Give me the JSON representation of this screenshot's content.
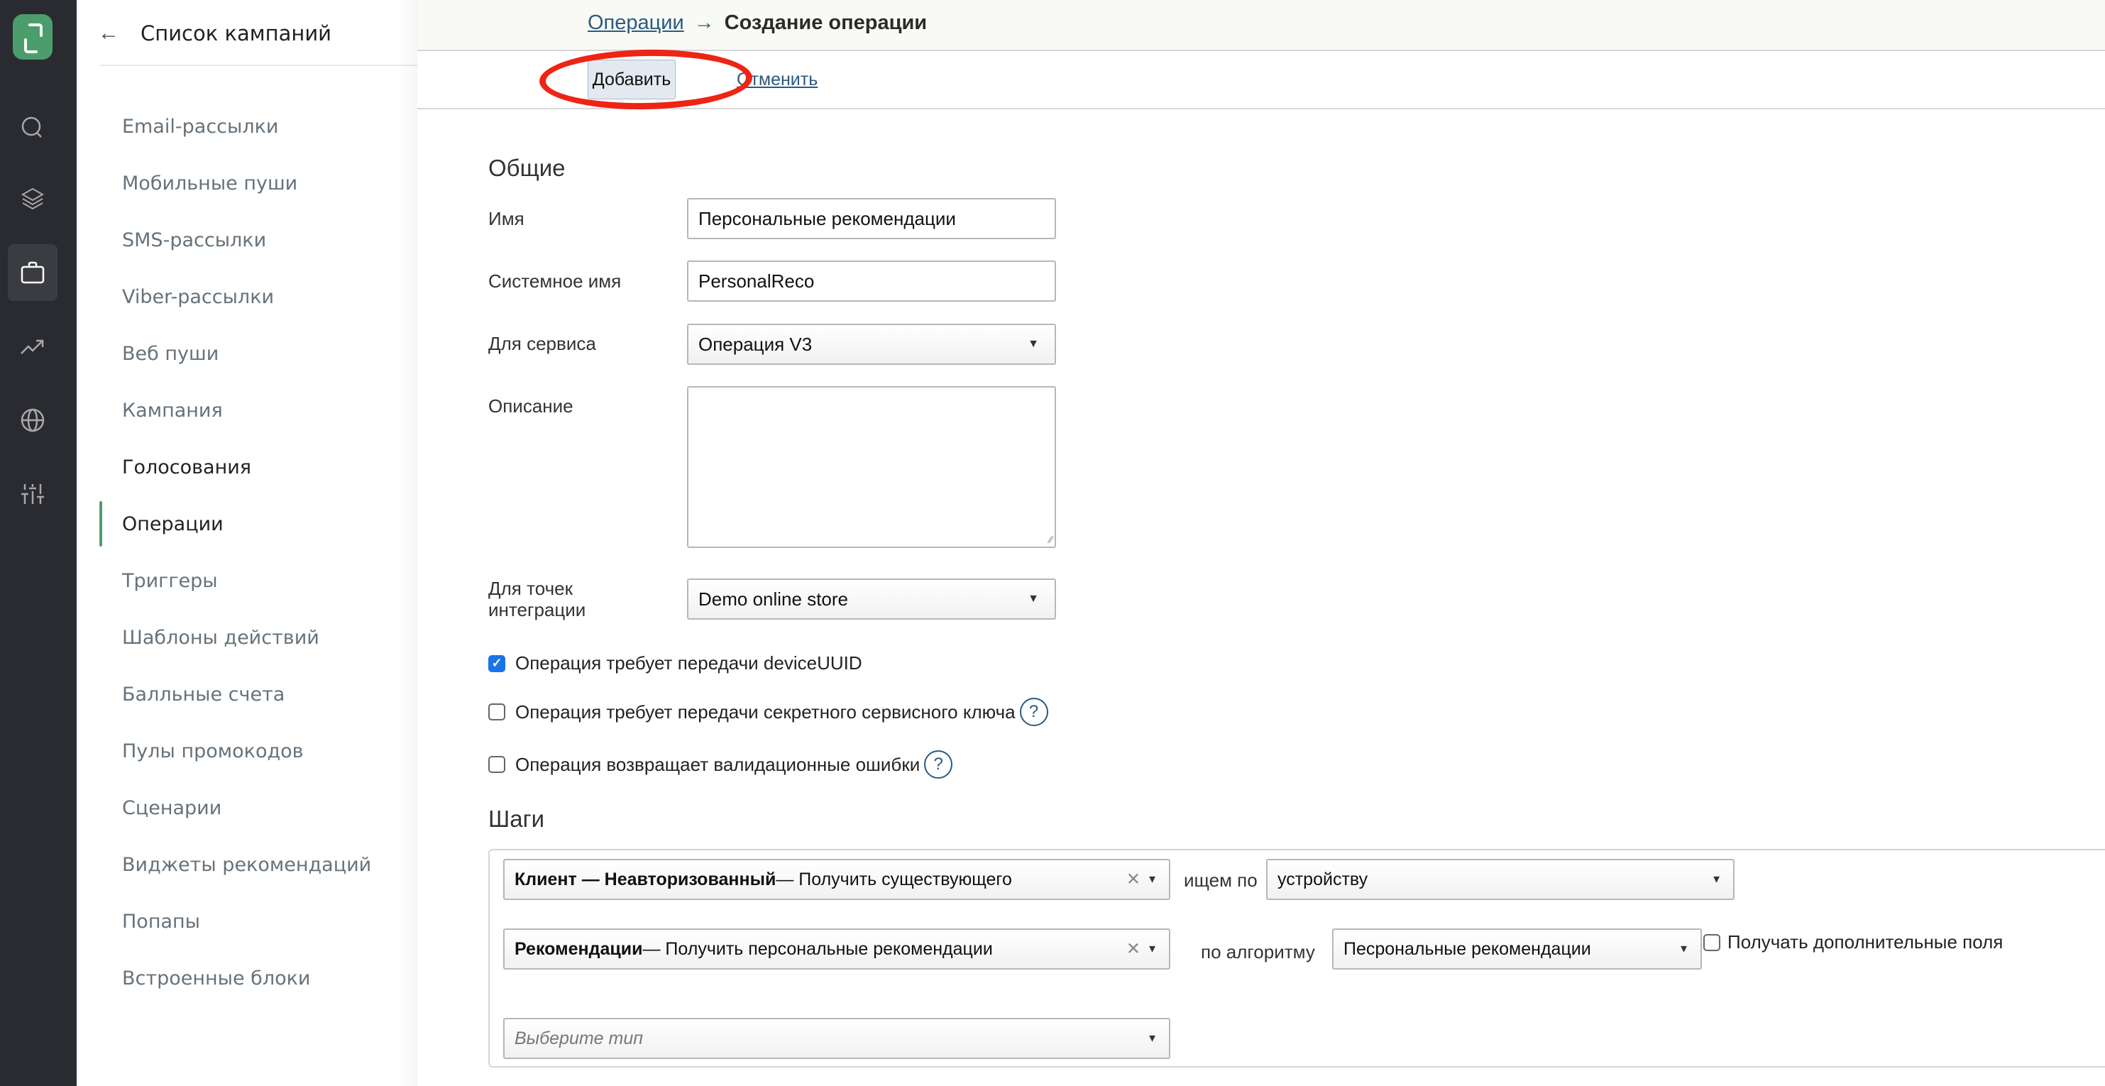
{
  "rail": {
    "items": [
      {
        "icon": "search-icon",
        "active": false
      },
      {
        "icon": "layers-icon",
        "active": false
      },
      {
        "icon": "briefcase-icon",
        "active": true
      },
      {
        "icon": "trending-up-icon",
        "active": false
      },
      {
        "icon": "globe-icon",
        "active": false
      },
      {
        "icon": "sliders-icon",
        "active": false
      }
    ]
  },
  "subnav": {
    "back_arrow": "←",
    "title": "Список кампаний",
    "items": [
      {
        "label": "Email-рассылки"
      },
      {
        "label": "Мобильные пуши"
      },
      {
        "label": "SMS-рассылки"
      },
      {
        "label": "Viber-рассылки"
      },
      {
        "label": "Веб пуши"
      },
      {
        "label": "Кампания"
      },
      {
        "label": "Голосования",
        "hover": true
      },
      {
        "label": "Операции",
        "active": true
      },
      {
        "label": "Триггеры"
      },
      {
        "label": "Шаблоны действий"
      },
      {
        "label": "Балльные счета"
      },
      {
        "label": "Пулы промокодов"
      },
      {
        "label": "Сценарии"
      },
      {
        "label": "Виджеты рекомендаций"
      },
      {
        "label": "Попапы"
      },
      {
        "label": "Встроенные блоки"
      }
    ]
  },
  "header": {
    "breadcrumb_link": "Операции",
    "breadcrumb_sep": "→",
    "breadcrumb_current": "Создание операции"
  },
  "toolbar": {
    "add_label": "Добавить",
    "cancel_label": "Отменить"
  },
  "form": {
    "section_general": "Общие",
    "name_label": "Имя",
    "name_value": "Персональные рекомендации",
    "system_name_label": "Системное имя",
    "system_name_value": "PersonalReco",
    "service_label": "Для сервиса",
    "service_value": "Операция V3",
    "description_label": "Описание",
    "description_value": "",
    "integration_label_line1": "Для точек",
    "integration_label_line2": "интеграции",
    "integration_value": "Demo online store",
    "checkboxes": [
      {
        "label": "Операция требует передачи deviceUUID",
        "checked": true,
        "help": false
      },
      {
        "label": "Операция требует передачи секретного сервисного ключа",
        "checked": false,
        "help": true
      },
      {
        "label": "Операция возвращает валидационные ошибки",
        "checked": false,
        "help": true
      }
    ],
    "help_glyph": "?",
    "check_glyph": "✓"
  },
  "steps": {
    "title": "Шаги",
    "clear_glyph": "✕",
    "caret_glyph": "▼",
    "rows": [
      {
        "bold": "Клиент — Неавторизованный",
        "rest": " — Получить существующего",
        "param_label": "ищем по",
        "param_value": "устройству"
      },
      {
        "bold": "Рекомендации",
        "rest": " — Получить персональные рекомендации",
        "param_label": "по алгоритму",
        "param_value": "Песрональные рекомендации",
        "extra_checkbox_label": "Получать дополнительные поля",
        "extra_checked": false
      }
    ],
    "new_step_placeholder": "Выберите тип"
  }
}
